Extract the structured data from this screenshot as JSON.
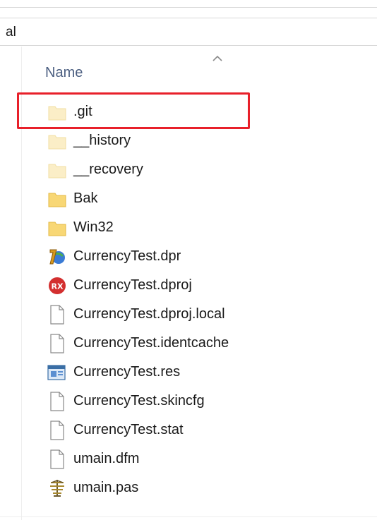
{
  "address_bar": {
    "text": "al"
  },
  "list_header": {
    "name_column": "Name"
  },
  "files": [
    {
      "name": ".git",
      "icon": "folder-faded-icon"
    },
    {
      "name": "__history",
      "icon": "folder-faded-icon"
    },
    {
      "name": "__recovery",
      "icon": "folder-faded-icon"
    },
    {
      "name": "Bak",
      "icon": "folder-icon"
    },
    {
      "name": "Win32",
      "icon": "folder-icon"
    },
    {
      "name": "CurrencyTest.dpr",
      "icon": "delphi-project-icon"
    },
    {
      "name": "CurrencyTest.dproj",
      "icon": "rad-studio-icon"
    },
    {
      "name": "CurrencyTest.dproj.local",
      "icon": "document-icon"
    },
    {
      "name": "CurrencyTest.identcache",
      "icon": "document-icon"
    },
    {
      "name": "CurrencyTest.res",
      "icon": "resource-file-icon"
    },
    {
      "name": "CurrencyTest.skincfg",
      "icon": "document-icon"
    },
    {
      "name": "CurrencyTest.stat",
      "icon": "document-icon"
    },
    {
      "name": "umain.dfm",
      "icon": "document-icon"
    },
    {
      "name": "umain.pas",
      "icon": "pascal-source-icon"
    }
  ],
  "colors": {
    "highlight": "#e8202a",
    "header_text": "#4d6082",
    "folder": "#f8d775",
    "folder_faded": "#fbeec7"
  }
}
